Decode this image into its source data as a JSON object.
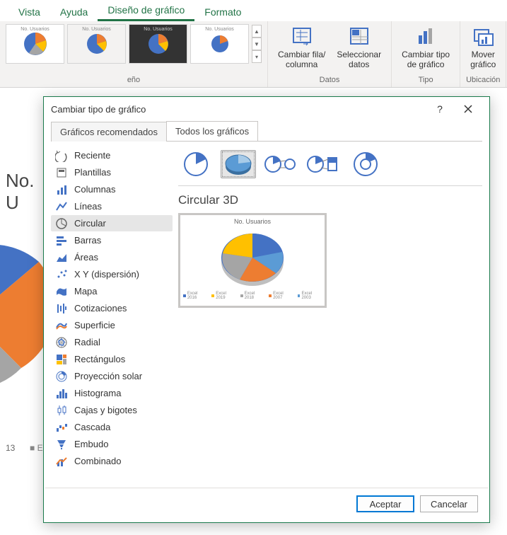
{
  "ribbon": {
    "tabs": [
      "Vista",
      "Ayuda",
      "Diseño de gráfico",
      "Formato"
    ],
    "active_index": 2,
    "groups": {
      "styles_cut_label": "eño",
      "data_label": "Datos",
      "type_label": "Tipo",
      "location_label": "Ubicación",
      "buttons": {
        "switch_rowcol": "Cambiar fila/\ncolumna",
        "select_data": "Seleccionar\ndatos",
        "change_type": "Cambiar tipo\nde gráfico",
        "move_chart": "Mover\ngráfico"
      },
      "style_thumb_title": "No. Usuarios"
    }
  },
  "sheet_fragment": {
    "title": "No. U",
    "row_label": "13",
    "legend_sep": "■ E"
  },
  "dialog": {
    "title": "Cambiar tipo de gráfico",
    "tabs": {
      "recommended": "Gráficos recomendados",
      "all": "Todos los gráficos"
    },
    "categories": [
      "Reciente",
      "Plantillas",
      "Columnas",
      "Líneas",
      "Circular",
      "Barras",
      "Áreas",
      "X Y (dispersión)",
      "Mapa",
      "Cotizaciones",
      "Superficie",
      "Radial",
      "Rectángulos",
      "Proyección solar",
      "Histograma",
      "Cajas y bigotes",
      "Cascada",
      "Embudo",
      "Combinado"
    ],
    "selected_category_index": 4,
    "subtype_title": "Circular 3D",
    "selected_subtype_index": 1,
    "preview": {
      "title": "No. Usuarios",
      "legend": [
        "Excel 2016",
        "Excel 2019",
        "Excel 2018",
        "Excel 2007",
        "Excel 2003"
      ]
    },
    "buttons": {
      "ok": "Aceptar",
      "cancel": "Cancelar"
    }
  },
  "chart_data": {
    "type": "pie",
    "title": "No. Usuarios",
    "categories": [
      "Excel 2016",
      "Excel 2019",
      "Excel 2018",
      "Excel 2007",
      "Excel 2003"
    ],
    "values": [
      35,
      10,
      15,
      30,
      10
    ],
    "colors": [
      "#4472c4",
      "#ffc000",
      "#a5a5a5",
      "#ed7d31",
      "#5b9bd5"
    ]
  }
}
